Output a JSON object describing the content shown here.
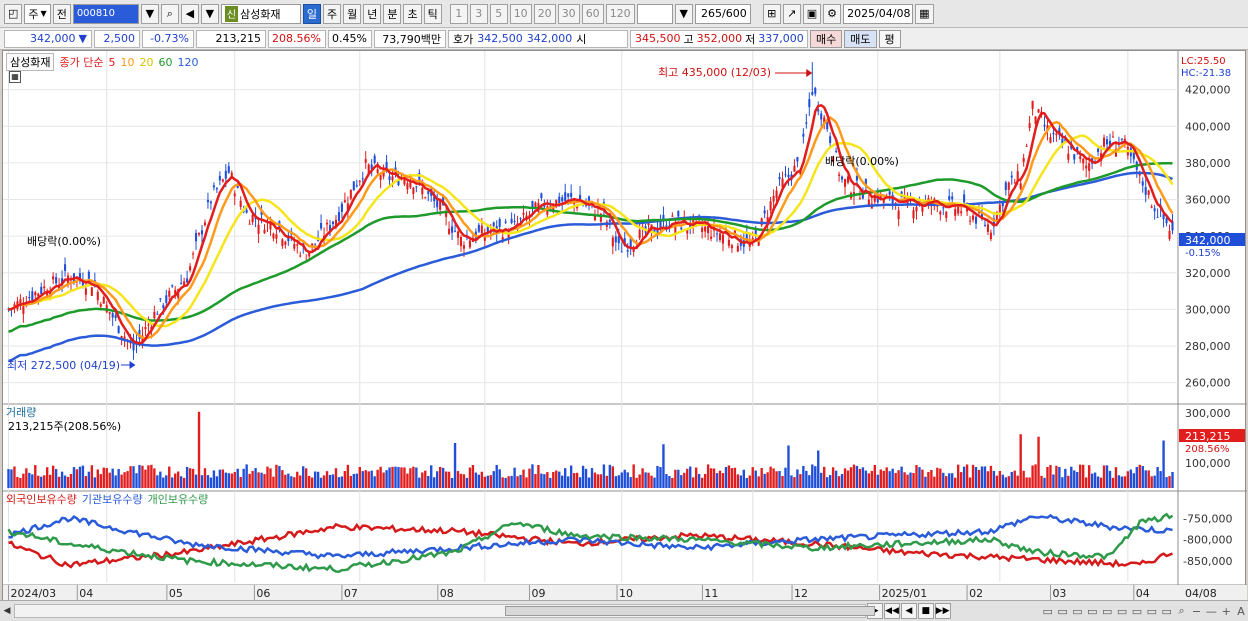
{
  "toolbar": {
    "market": "주",
    "prefix": "전",
    "code": "000810",
    "new_badge": "신",
    "stock_name": "삼성화재",
    "periods": [
      "일",
      "주",
      "월",
      "년",
      "분",
      "초",
      "틱"
    ],
    "active_period": "일",
    "intervals": [
      "1",
      "3",
      "5",
      "10",
      "20",
      "30",
      "60",
      "120"
    ],
    "count": "265",
    "total": "/600",
    "date": "2025/04/08"
  },
  "pricebar": {
    "price": "342,000",
    "change_sign": "▼",
    "change": "2,500",
    "change_rate": "-0.73%",
    "volume": "213,215",
    "volume_rate": "208.56%",
    "turnover_rate": "0.45%",
    "amount": "73,790백만",
    "quote_label": "호가",
    "ask": "342,500",
    "bid": "342,000",
    "open_label": "시",
    "open": "345,500",
    "high_label": "고",
    "high": "352,000",
    "low_label": "저",
    "low": "337,000",
    "buy_label": "매수",
    "sell_label": "매도",
    "avg_label": "평"
  },
  "legend": {
    "stock": "삼성화재",
    "ma_prefix": "종가 단순",
    "ma": [
      "5",
      "10",
      "20",
      "60",
      "120"
    ],
    "volume_title": "거래량",
    "volume_value": "213,215주(208.56%)",
    "holdings": [
      "외국인보유수량",
      "기관보유수량",
      "개인보유수량"
    ]
  },
  "annotations": {
    "lc": "LC:25.50",
    "hc": "HC:-21.38",
    "high_note": "최고 435,000 (12/03)",
    "low_note": "최저 272,500 (04/19)",
    "div1": "배당락(0.00%)",
    "div2": "배당락(0.00%)",
    "price_tag": "342,000",
    "price_pct": "-0.15%",
    "vol_tag": "213,215",
    "vol_pct": "208.56%"
  },
  "colors": {
    "up": "#e11d1d",
    "down": "#1f4fd8",
    "ma5": "#e11d1d",
    "ma10": "#ff9a1a",
    "ma20": "#f5e51a",
    "ma60": "#1d9a2a",
    "ma120": "#2a5bd8",
    "foreign": "#d41a1a",
    "institution": "#2a5bd8",
    "individual": "#2e9a4a"
  },
  "chart_data": {
    "type": "candlestick",
    "y_ticks": [
      "420,000",
      "400,000",
      "380,000",
      "360,000",
      "340,000",
      "320,000",
      "300,000",
      "280,000",
      "260,000"
    ],
    "y_range": [
      250000,
      440000
    ],
    "volume_ticks": [
      "300,000",
      "200,000",
      "100,000"
    ],
    "volume_range": [
      0,
      320000
    ],
    "holding_ticks": [
      "-750,000",
      "-800,000",
      "-850,000"
    ],
    "x_labels": [
      "2024/03",
      "04",
      "05",
      "06",
      "07",
      "08",
      "09",
      "10",
      "11",
      "12",
      "2025/01",
      "02",
      "03",
      "04",
      "04/08"
    ],
    "anchors_close": [
      [
        0,
        300000
      ],
      [
        10,
        310000
      ],
      [
        20,
        318000
      ],
      [
        28,
        315000
      ],
      [
        35,
        296000
      ],
      [
        42,
        278000
      ],
      [
        50,
        300000
      ],
      [
        60,
        318000
      ],
      [
        68,
        360000
      ],
      [
        74,
        375000
      ],
      [
        80,
        352000
      ],
      [
        90,
        345000
      ],
      [
        100,
        330000
      ],
      [
        110,
        350000
      ],
      [
        120,
        378000
      ],
      [
        128,
        372000
      ],
      [
        135,
        372000
      ],
      [
        145,
        355000
      ],
      [
        152,
        338000
      ],
      [
        160,
        342000
      ],
      [
        170,
        345000
      ],
      [
        180,
        358000
      ],
      [
        190,
        360000
      ],
      [
        200,
        352000
      ],
      [
        205,
        333000
      ],
      [
        212,
        340000
      ],
      [
        222,
        348000
      ],
      [
        232,
        345000
      ],
      [
        242,
        340000
      ],
      [
        250,
        335000
      ],
      [
        258,
        365000
      ],
      [
        266,
        380000
      ],
      [
        270,
        420000
      ],
      [
        275,
        400000
      ],
      [
        280,
        370000
      ],
      [
        290,
        362000
      ],
      [
        300,
        358000
      ],
      [
        310,
        358000
      ],
      [
        320,
        355000
      ],
      [
        330,
        345000
      ],
      [
        336,
        368000
      ],
      [
        340,
        372000
      ],
      [
        344,
        410000
      ],
      [
        350,
        395000
      ],
      [
        356,
        388000
      ],
      [
        362,
        378000
      ],
      [
        368,
        390000
      ],
      [
        374,
        392000
      ],
      [
        380,
        372000
      ],
      [
        385,
        356000
      ],
      [
        389,
        347000
      ],
      [
        391,
        342000
      ]
    ],
    "volume_spikes": [
      [
        64,
        305000
      ],
      [
        150,
        180000
      ],
      [
        220,
        175000
      ],
      [
        262,
        170000
      ],
      [
        272,
        150000
      ],
      [
        340,
        215000
      ],
      [
        346,
        205000
      ],
      [
        388,
        190000
      ]
    ],
    "holdings": {
      "foreign": [
        [
          0,
          -810000
        ],
        [
          20,
          -860000
        ],
        [
          60,
          -830000
        ],
        [
          110,
          -770000
        ],
        [
          150,
          -780000
        ],
        [
          190,
          -810000
        ],
        [
          230,
          -790000
        ],
        [
          270,
          -810000
        ],
        [
          300,
          -830000
        ],
        [
          340,
          -845000
        ],
        [
          380,
          -860000
        ],
        [
          391,
          -830000
        ]
      ],
      "institution": [
        [
          0,
          -790000
        ],
        [
          20,
          -750000
        ],
        [
          60,
          -810000
        ],
        [
          110,
          -840000
        ],
        [
          150,
          -820000
        ],
        [
          190,
          -800000
        ],
        [
          230,
          -820000
        ],
        [
          270,
          -800000
        ],
        [
          300,
          -790000
        ],
        [
          330,
          -780000
        ],
        [
          345,
          -745000
        ],
        [
          370,
          -770000
        ],
        [
          391,
          -780000
        ]
      ],
      "individual": [
        [
          0,
          -780000
        ],
        [
          20,
          -810000
        ],
        [
          60,
          -850000
        ],
        [
          110,
          -870000
        ],
        [
          150,
          -830000
        ],
        [
          170,
          -760000
        ],
        [
          190,
          -790000
        ],
        [
          230,
          -800000
        ],
        [
          270,
          -820000
        ],
        [
          300,
          -810000
        ],
        [
          330,
          -800000
        ],
        [
          345,
          -830000
        ],
        [
          370,
          -840000
        ],
        [
          380,
          -760000
        ],
        [
          391,
          -745000
        ]
      ]
    },
    "n_bars": 392
  }
}
